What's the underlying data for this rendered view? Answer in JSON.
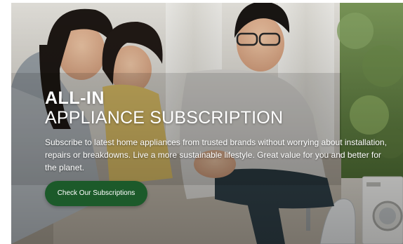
{
  "hero": {
    "title_bold": "ALL-IN",
    "title_light": "APPLIANCE SUBSCRIPTION",
    "description": "Subscribe to latest home appliances from trusted brands without worrying about installation, repairs or breakdowns. Live a more sustainable lifestyle. Great value for you and better for the planet.",
    "cta_label": "Check Our Subscriptions"
  },
  "colors": {
    "cta_background": "#1c5a2a",
    "text": "#ffffff"
  },
  "image": {
    "icon": "family-on-sofa-photo"
  }
}
